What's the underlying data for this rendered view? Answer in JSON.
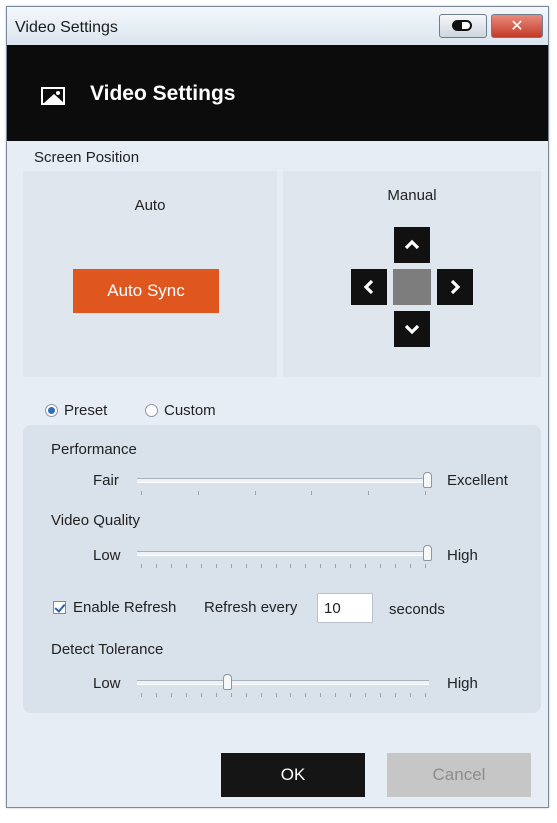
{
  "window": {
    "title": "Video Settings",
    "close_label": "✕"
  },
  "header": {
    "icon": "picture-icon",
    "title": "Video Settings"
  },
  "screen_position": {
    "label": "Screen Position",
    "auto": {
      "title": "Auto",
      "button_label": "Auto Sync"
    },
    "manual": {
      "title": "Manual",
      "icons": [
        "arrow-up-icon",
        "arrow-left-icon",
        "arrow-right-icon",
        "arrow-down-icon"
      ]
    }
  },
  "mode": {
    "options": [
      {
        "label": "Preset",
        "selected": true
      },
      {
        "label": "Custom",
        "selected": false
      }
    ]
  },
  "performance": {
    "label": "Performance",
    "min_label": "Fair",
    "max_label": "Excellent",
    "value": 1.0
  },
  "video_quality": {
    "label": "Video Quality",
    "min_label": "Low",
    "max_label": "High",
    "value": 1.0
  },
  "refresh": {
    "checkbox_label": "Enable Refresh",
    "checked": true,
    "every_label": "Refresh every",
    "interval": "10",
    "unit_label": "seconds"
  },
  "detect_tolerance": {
    "label": "Detect Tolerance",
    "min_label": "Low",
    "max_label": "High",
    "value": 0.3
  },
  "footer": {
    "ok_label": "OK",
    "cancel_label": "Cancel"
  },
  "colors": {
    "accent_orange": "#e0561f",
    "header_black": "#0c0c0c",
    "ok_button": "#151515",
    "cancel_disabled": "#c6c6c6"
  }
}
